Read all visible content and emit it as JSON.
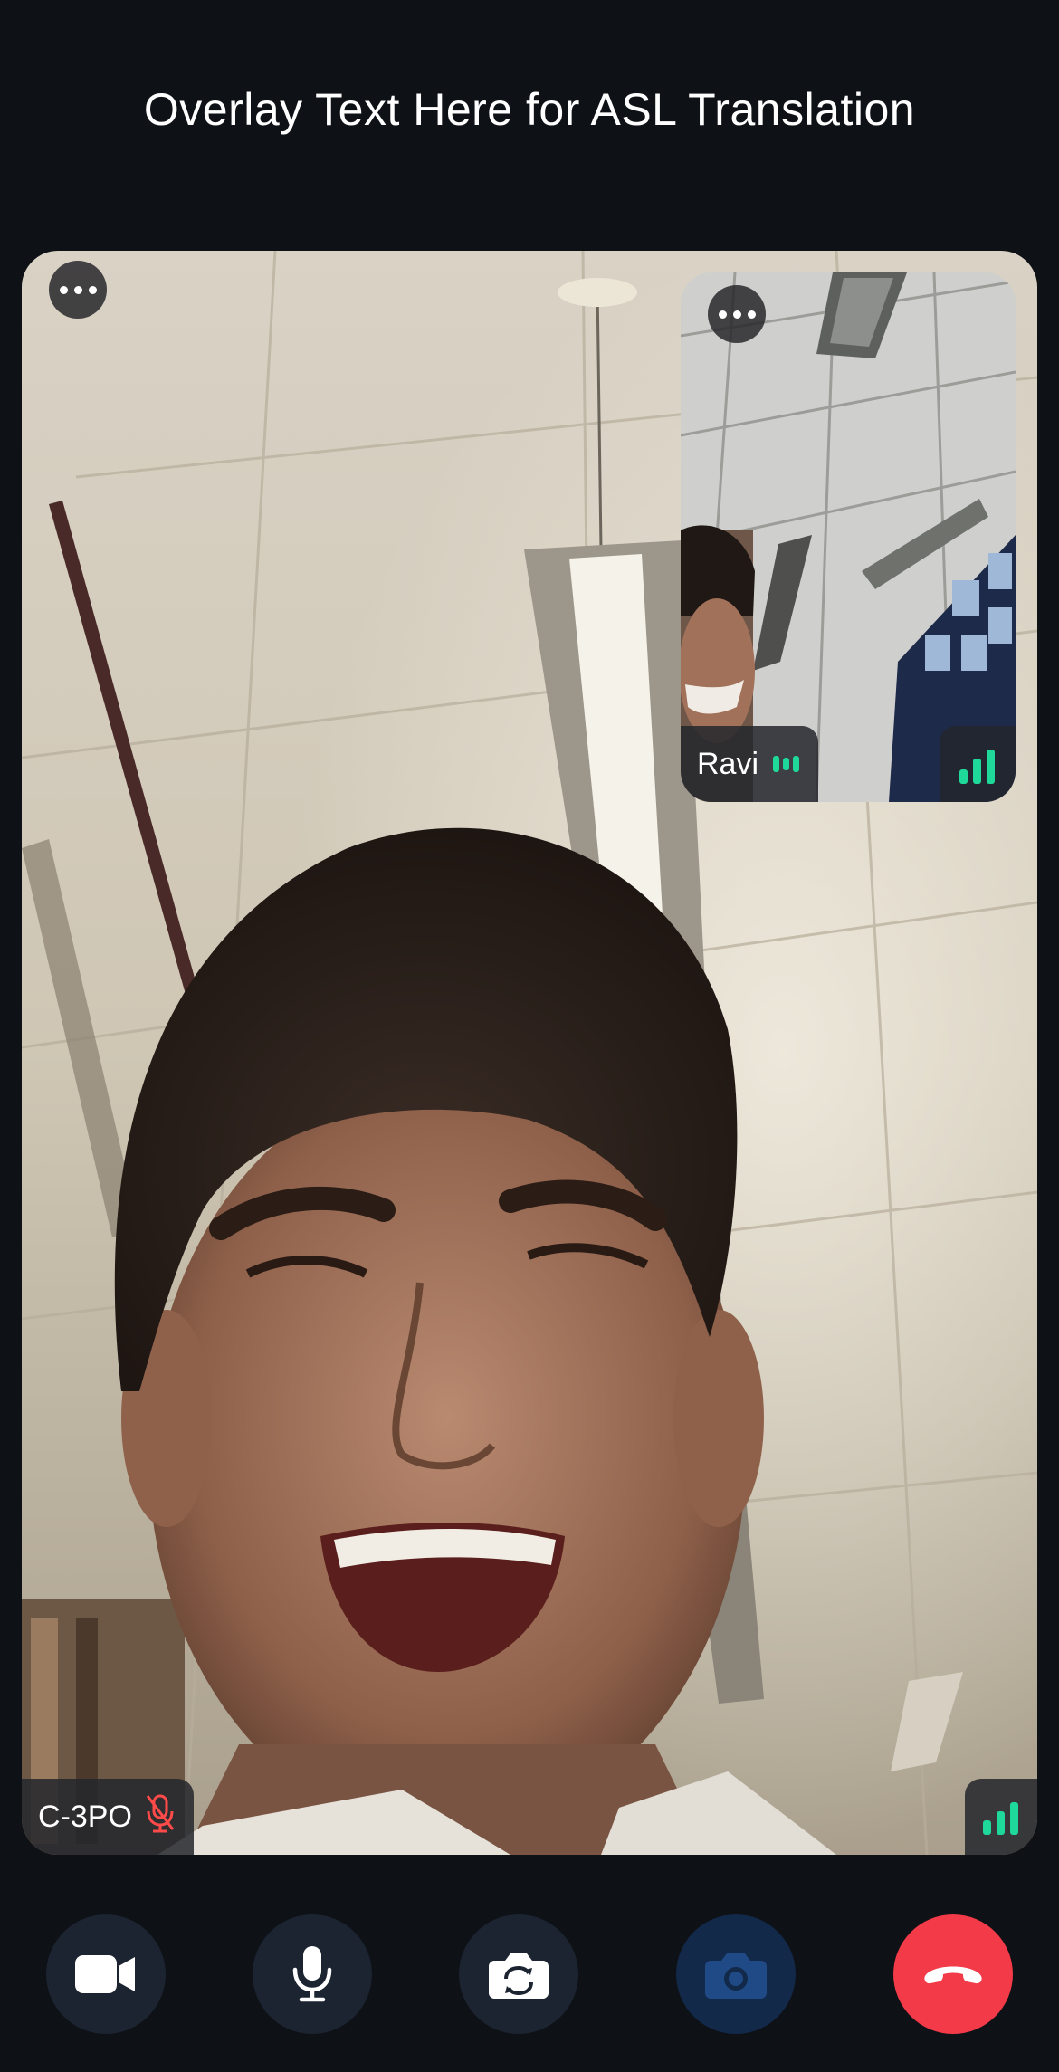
{
  "overlay": {
    "text": "Overlay Text Here for ASL Translation"
  },
  "main_participant": {
    "name": "C-3PO",
    "mic_status": "muted",
    "more_icon": "more-horizontal-icon",
    "signal_icon": "signal-strength-icon"
  },
  "pip_participant": {
    "name": "Ravi",
    "speaking_icon": "audio-level-icon",
    "more_icon": "more-horizontal-icon",
    "signal_icon": "signal-strength-icon"
  },
  "controls": [
    {
      "name": "camera-toggle",
      "icon": "video-camera-icon"
    },
    {
      "name": "mic-toggle",
      "icon": "microphone-icon"
    },
    {
      "name": "flip-camera",
      "icon": "camera-switch-icon"
    },
    {
      "name": "screenshot",
      "icon": "camera-icon",
      "state": "disabled"
    },
    {
      "name": "end-call",
      "icon": "phone-hangup-icon"
    }
  ],
  "colors": {
    "background": "#0e1116",
    "button": "#1b2430",
    "button_disabled": "#12294a",
    "end_call": "#f23a48",
    "signal": "#1ed99a",
    "muted": "#ff4a4a"
  }
}
